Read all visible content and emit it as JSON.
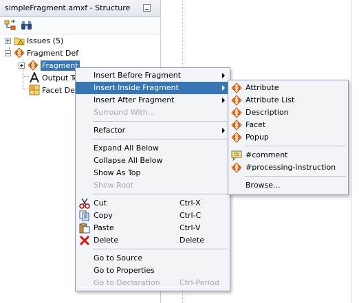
{
  "panel": {
    "title": "simpleFragment.amxf - Structure"
  },
  "toolbar": {
    "buttons": [
      {
        "name": "xml-structure-icon"
      },
      {
        "name": "binoculars-icon"
      }
    ]
  },
  "tree": {
    "issues": "Issues (5)",
    "fragment_def": "Fragment Def",
    "fragment": "Fragment",
    "output_text": "Output Te",
    "facet_def": "Facet Def"
  },
  "context_menu": {
    "items": [
      {
        "label": "Insert Before Fragment",
        "shortcut": "",
        "submenu": true,
        "disabled": false
      },
      {
        "label": "Insert Inside Fragment",
        "shortcut": "",
        "submenu": true,
        "disabled": false,
        "highlighted": true
      },
      {
        "label": "Insert After Fragment",
        "shortcut": "",
        "submenu": true,
        "disabled": false
      },
      {
        "label": "Surround With...",
        "shortcut": "",
        "disabled": true
      },
      {
        "label": "Refactor",
        "shortcut": "",
        "submenu": true,
        "disabled": false
      },
      {
        "label": "Expand All Below",
        "shortcut": "",
        "disabled": false
      },
      {
        "label": "Collapse All Below",
        "shortcut": "",
        "disabled": false
      },
      {
        "label": "Show As Top",
        "shortcut": "",
        "disabled": false
      },
      {
        "label": "Show Root",
        "shortcut": "",
        "disabled": true
      },
      {
        "label": "Cut",
        "shortcut": "Ctrl-X",
        "icon": "scissors-icon",
        "disabled": false
      },
      {
        "label": "Copy",
        "shortcut": "Ctrl-C",
        "icon": "copy-icon",
        "disabled": false
      },
      {
        "label": "Paste",
        "shortcut": "Ctrl-V",
        "icon": "paste-icon",
        "disabled": false
      },
      {
        "label": "Delete",
        "shortcut": "Delete",
        "icon": "delete-x-icon",
        "disabled": false
      },
      {
        "label": "Go to Source",
        "shortcut": "",
        "disabled": false
      },
      {
        "label": "Go to Properties",
        "shortcut": "",
        "disabled": false
      },
      {
        "label": "Go to Declaration",
        "shortcut": "Ctrl-Period",
        "disabled": true
      }
    ]
  },
  "submenu": {
    "items": [
      {
        "label": "Attribute",
        "icon": "xml-element-icon"
      },
      {
        "label": "Attribute List",
        "icon": "xml-element-icon"
      },
      {
        "label": "Description",
        "icon": "xml-element-icon"
      },
      {
        "label": "Facet",
        "icon": "xml-element-icon"
      },
      {
        "label": "Popup",
        "icon": "xml-element-icon"
      },
      {
        "label": "#comment",
        "icon": "comment-icon"
      },
      {
        "label": "#processing-instruction",
        "icon": "xml-element-icon"
      },
      {
        "label": "Browse...",
        "icon": ""
      }
    ]
  },
  "colors": {
    "selection": "#3875b5",
    "menu_bg": "#f2f4f7",
    "element_icon": "#d86b1c"
  }
}
